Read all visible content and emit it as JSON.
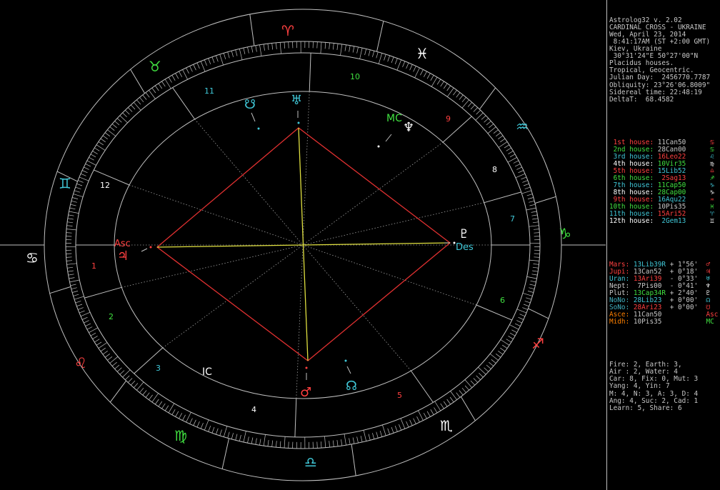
{
  "header": {
    "lines": [
      "Astrolog32 v. 2.02",
      "CARDINAL CROSS - UKRAINE",
      "Wed, April 23, 2014",
      " 8:41:17AM (ST +2:00 GMT)",
      "Kiev, Ukraine",
      " 30°31'24\"E 50°27'00\"N",
      "Placidus houses.",
      "Tropical, Geocentric.",
      "Julian Day:  2456770.7787",
      "Obliquity: 23°26'06.8009\"",
      "Sidereal time: 22:48:19",
      "DeltaT:  68.4582"
    ]
  },
  "houses": [
    {
      "label": "1st house:",
      "value": "11Can50",
      "color": "#ff4040",
      "value_color": "#c8c8c8",
      "glyph": "♋"
    },
    {
      "label": "2nd house:",
      "value": "28Can00",
      "color": "#40e040",
      "value_color": "#c8c8c8",
      "glyph": "♋"
    },
    {
      "label": "3rd house:",
      "value": "16Leo22",
      "color": "#40c8d8",
      "value_color": "#ff4040",
      "glyph": "♌"
    },
    {
      "label": "4th house:",
      "value": "10Vir35",
      "color": "#ffffff",
      "value_color": "#40e040",
      "glyph": "♍"
    },
    {
      "label": "5th house:",
      "value": "15Lib52",
      "color": "#ff4040",
      "value_color": "#40c8d8",
      "glyph": "♎"
    },
    {
      "label": "6th house:",
      "value": " 2Sag13",
      "color": "#40e040",
      "value_color": "#ff4040",
      "glyph": "♐"
    },
    {
      "label": "7th house:",
      "value": "11Cap50",
      "color": "#40c8d8",
      "value_color": "#40e040",
      "glyph": "♑"
    },
    {
      "label": "8th house:",
      "value": "28Cap00",
      "color": "#ffffff",
      "value_color": "#40e040",
      "glyph": "♑"
    },
    {
      "label": "9th house:",
      "value": "16Aqu22",
      "color": "#ff4040",
      "value_color": "#40c8d8",
      "glyph": "♒"
    },
    {
      "label": "10th house:",
      "value": "10Pis35",
      "color": "#40e040",
      "value_color": "#c8c8c8",
      "glyph": "♓"
    },
    {
      "label": "11th house:",
      "value": "15Ari52",
      "color": "#40c8d8",
      "value_color": "#ff4040",
      "glyph": "♈"
    },
    {
      "label": "12th house:",
      "value": " 2Gem13",
      "color": "#ffffff",
      "value_color": "#40c8d8",
      "glyph": "♊"
    }
  ],
  "planets": [
    {
      "name": "Mars:",
      "pos": "13Lib39R",
      "extra": " + 1°56'",
      "name_color": "#ff4040",
      "pos_color": "#40c8d8",
      "glyph": "♂",
      "glyph_color": "#ff4040"
    },
    {
      "name": "Jupi:",
      "pos": "13Can52",
      "extra": " + 0°18'",
      "name_color": "#ff4040",
      "pos_color": "#c8c8c8",
      "glyph": "♃",
      "glyph_color": "#ff4040"
    },
    {
      "name": "Uran:",
      "pos": "13Ari39",
      "extra": " - 0°33'",
      "name_color": "#40c8d8",
      "pos_color": "#ff4040",
      "glyph": "♅",
      "glyph_color": "#40c8d8"
    },
    {
      "name": "Nept:",
      "pos": " 7Pis00",
      "extra": " - 0°41'",
      "name_color": "#c8c8c8",
      "pos_color": "#c8c8c8",
      "glyph": "♆",
      "glyph_color": "#ffffff"
    },
    {
      "name": "Plut:",
      "pos": "13Cap34R",
      "extra": " + 2°40'",
      "name_color": "#c8c8c8",
      "pos_color": "#40e040",
      "glyph": "♇",
      "glyph_color": "#ffffff"
    },
    {
      "name": "NoNo:",
      "pos": "28Lib23",
      "extra": " + 0°00'",
      "name_color": "#40b0c0",
      "pos_color": "#40c8d8",
      "glyph": "☊",
      "glyph_color": "#40c8d8"
    },
    {
      "name": "SoNo:",
      "pos": "28Ari23",
      "extra": " + 0°00'",
      "name_color": "#40b0c0",
      "pos_color": "#ff4040",
      "glyph": "☋",
      "glyph_color": "#ff4040"
    },
    {
      "name": "Asce:",
      "pos": "11Can50",
      "extra": "",
      "name_color": "#ff8000",
      "pos_color": "#c8c8c8",
      "glyph": "Asc",
      "glyph_color": "#ff4040"
    },
    {
      "name": "Midh:",
      "pos": "10Pis35",
      "extra": "",
      "name_color": "#ff8000",
      "pos_color": "#c8c8c8",
      "glyph": "MC",
      "glyph_color": "#40e040"
    }
  ],
  "stats": [
    "Fire: 2, Earth: 3,",
    "Air : 2, Water: 4",
    "Car: 8, Fix: 0, Mut: 3",
    "Yang: 4, Yin: 7",
    "M: 4, N: 3, A: 3, D: 4",
    "Ang: 4, Suc: 2, Cad: 1",
    "Learn: 5, Share: 6"
  ],
  "wheel": {
    "house_numbers": [
      "1",
      "2",
      "3",
      "4",
      "5",
      "6",
      "7",
      "8",
      "9",
      "10",
      "11",
      "12"
    ],
    "house_number_colors": [
      "#ff4040",
      "#40e040",
      "#40c8d8",
      "#ffffff",
      "#ff4040",
      "#40e040",
      "#40c8d8",
      "#ffffff",
      "#ff4040",
      "#40e040",
      "#40c8d8",
      "#ffffff"
    ],
    "signs": [
      {
        "glyph": "♋",
        "color": "#ffffff",
        "name": "cancer"
      },
      {
        "glyph": "♌",
        "color": "#ff4040",
        "name": "leo"
      },
      {
        "glyph": "♍",
        "color": "#40e040",
        "name": "virgo"
      },
      {
        "glyph": "♎",
        "color": "#40c8d8",
        "name": "libra"
      },
      {
        "glyph": "♏",
        "color": "#ffffff",
        "name": "scorpio"
      },
      {
        "glyph": "♐",
        "color": "#ff4040",
        "name": "sagittarius"
      },
      {
        "glyph": "♑",
        "color": "#40e040",
        "name": "capricorn"
      },
      {
        "glyph": "♒",
        "color": "#40c8d8",
        "name": "aquarius"
      },
      {
        "glyph": "♓",
        "color": "#ffffff",
        "name": "pisces"
      },
      {
        "glyph": "♈",
        "color": "#ff4040",
        "name": "aries"
      },
      {
        "glyph": "♉",
        "color": "#40e040",
        "name": "taurus"
      },
      {
        "glyph": "♊",
        "color": "#40c8d8",
        "name": "gemini"
      }
    ],
    "angle_labels": {
      "asc": "Asc",
      "des": "Des",
      "mc": "MC",
      "ic": "IC"
    },
    "angle_colors": {
      "asc": "#ff4040",
      "des": "#40c8d8",
      "mc": "#40e040",
      "ic": "#ffffff"
    },
    "planet_glyphs": {
      "uranus": "♅",
      "neptune": "♆",
      "pluto": "♇",
      "mars": "♂",
      "jupiter": "♃",
      "north_node": "☊",
      "south_node": "☋"
    },
    "planet_colors": {
      "uranus": "#40c8d8",
      "neptune": "#ffffff",
      "pluto": "#ffffff",
      "mars": "#ff4040",
      "jupiter": "#ff4040",
      "north_node": "#40c8d8",
      "south_node": "#40c8d8"
    }
  },
  "colors": {
    "background": "#000000",
    "lines": "#c0c0c0",
    "square": "#e03030",
    "opposition": "#e0e040"
  }
}
